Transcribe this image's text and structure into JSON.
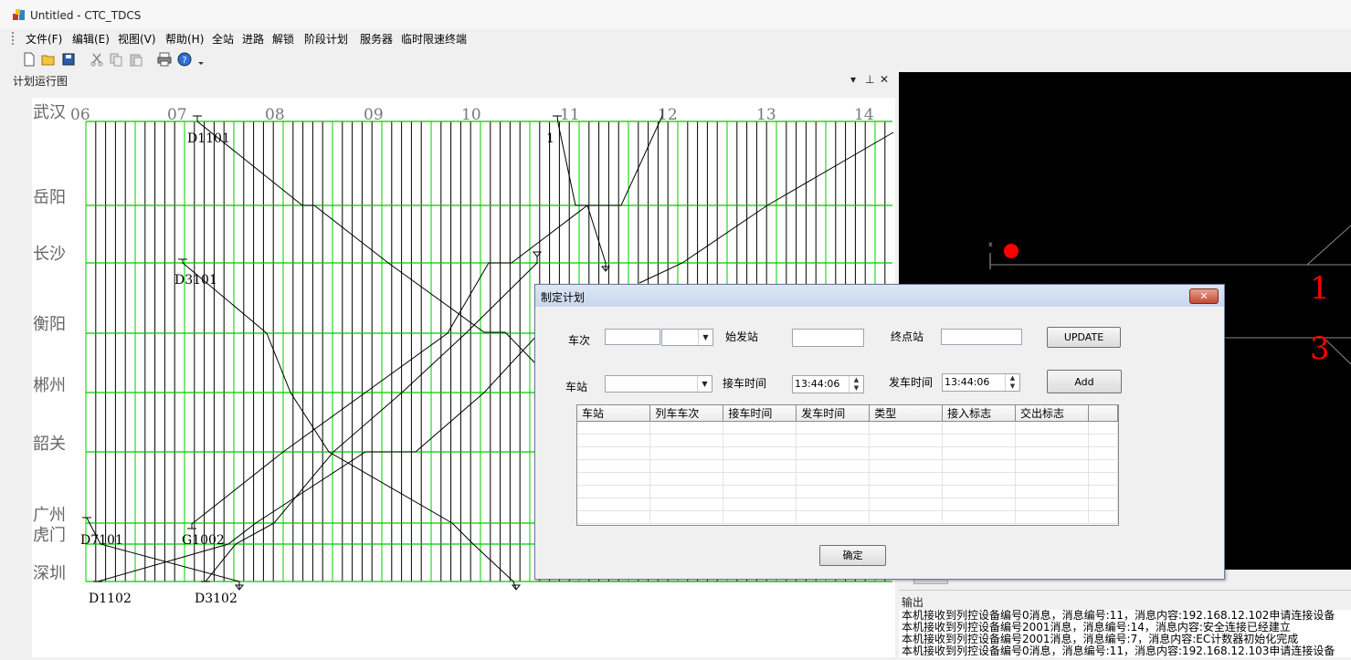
{
  "window": {
    "title": "Untitled - CTC_TDCS"
  },
  "menu": [
    {
      "label": "文件(F)"
    },
    {
      "label": "编辑(E)"
    },
    {
      "label": "视图(V)"
    },
    {
      "label": "帮助(H)"
    },
    {
      "label": "全站"
    },
    {
      "label": "进路"
    },
    {
      "label": "解锁"
    },
    {
      "label": "阶段计划"
    },
    {
      "label": "服务器"
    },
    {
      "label": "临时限速终端"
    }
  ],
  "toolbar": [
    "new-icon",
    "open-icon",
    "save-icon",
    "cut-icon",
    "copy-icon",
    "paste-icon",
    "print-icon",
    "help-icon"
  ],
  "panel": {
    "title": "计划运行图"
  },
  "chart": {
    "hours": [
      "06",
      "07",
      "08",
      "09",
      "10",
      "11",
      "12",
      "13",
      "14"
    ],
    "stations": [
      "武汉",
      "岳阳",
      "长沙",
      "衡阳",
      "郴州",
      "韶关",
      "广州",
      "虎门",
      "深圳"
    ],
    "trains": [
      "D1101",
      "1",
      "D3101",
      "D7101",
      "G1002",
      "D1102",
      "D3102"
    ],
    "grid_color": "#00cc00"
  },
  "black_pane": {
    "labels": [
      "1",
      "3"
    ],
    "small_label": "x",
    "accent": "#ff0000"
  },
  "dialog": {
    "title": "制定计划",
    "train_no_label": "车次",
    "origin_label": "始发站",
    "terminal_label": "终点站",
    "update_button": "UPDATE",
    "station_label": "车站",
    "arrive_label": "接车时间",
    "arrive_time": "13:44:06",
    "depart_label": "发车时间",
    "depart_time": "13:44:06",
    "add_button": "Add",
    "columns": [
      "车站",
      "列车车次",
      "接车时间",
      "发车时间",
      "类型",
      "接入标志",
      "交出标志"
    ],
    "ok_button": "确定"
  },
  "output": {
    "title": "输出",
    "lines": [
      "本机接收到列控设备编号0消息，消息编号:11，消息内容:192.168.12.102申请连接设备",
      "本机接收到列控设备编号2001消息，消息编号:14，消息内容:安全连接已经建立",
      "本机接收到列控设备编号2001消息，消息编号:7，消息内容:EC计数器初始化完成",
      "本机接收到列控设备编号0消息，消息编号:11，消息内容:192.168.12.103申请连接设备"
    ]
  }
}
